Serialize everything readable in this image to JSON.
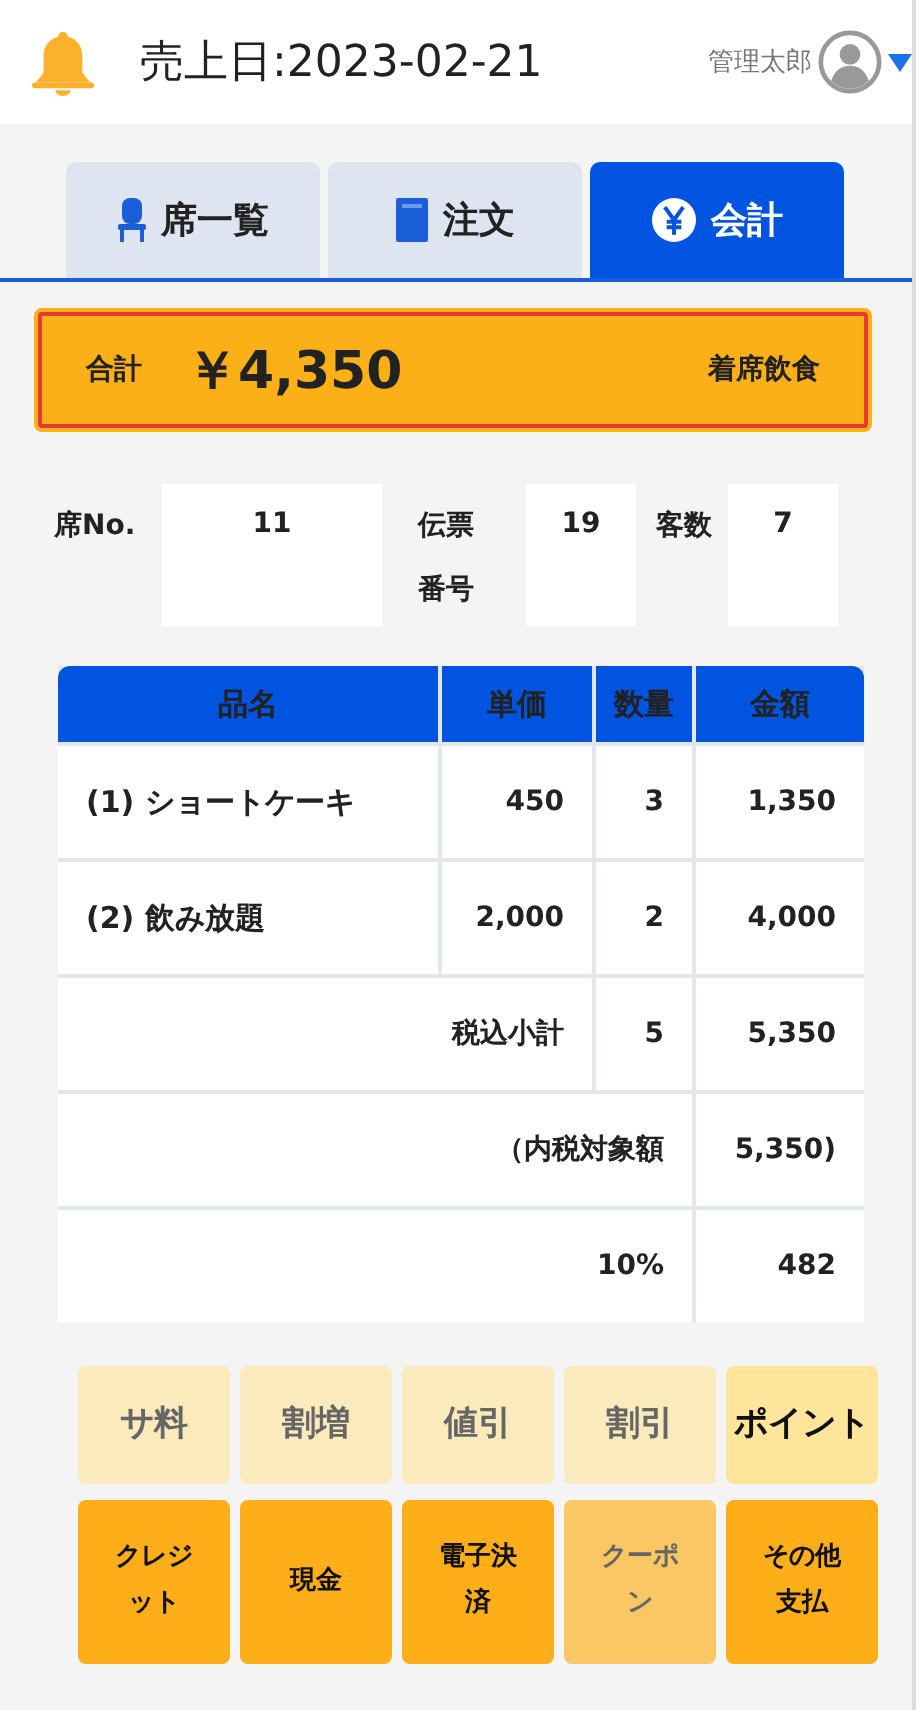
{
  "header": {
    "title": "売上日:2023-02-21",
    "user_name": "管理太郎"
  },
  "tabs": [
    {
      "label": "席一覧",
      "kind": "seats",
      "selected": false
    },
    {
      "label": "注文",
      "kind": "order",
      "selected": false
    },
    {
      "label": "会計",
      "kind": "bill",
      "selected": true
    }
  ],
  "total": {
    "label": "合計",
    "amount": "￥4,350",
    "service_type": "着席飲食"
  },
  "info": [
    {
      "label": "席No.",
      "value": "11"
    },
    {
      "label": "伝票番号",
      "value": "19"
    },
    {
      "label": "客数",
      "value": "7"
    }
  ],
  "table": {
    "columns": [
      "品名",
      "単価",
      "数量",
      "金額"
    ],
    "rows": [
      {
        "kind": "item",
        "cells": [
          "(1) ショートケーキ",
          "450",
          "3",
          "1,350"
        ]
      },
      {
        "kind": "item",
        "cells": [
          "(2) 飲み放題",
          "2,000",
          "2",
          "4,000"
        ]
      },
      {
        "kind": "subtotal",
        "cells": [
          "",
          "税込小計",
          "5",
          "5,350"
        ]
      },
      {
        "kind": "tax",
        "cells": [
          "",
          "",
          "（内税対象額",
          "5,350)"
        ]
      },
      {
        "kind": "tax",
        "cells": [
          "",
          "",
          "10%",
          "482"
        ]
      }
    ]
  },
  "adjust_buttons": [
    {
      "label": "サ料",
      "disabled": true
    },
    {
      "label": "割増",
      "disabled": true
    },
    {
      "label": "値引",
      "disabled": true
    },
    {
      "label": "割引",
      "disabled": true
    },
    {
      "label": "ポイント",
      "disabled": false
    }
  ],
  "payment_buttons": [
    {
      "label": "クレジット",
      "disabled": false
    },
    {
      "label": "現金",
      "disabled": false
    },
    {
      "label": "電子決済",
      "disabled": false
    },
    {
      "label": "クーポン",
      "disabled": true
    },
    {
      "label": "その他支払",
      "disabled": false
    }
  ]
}
